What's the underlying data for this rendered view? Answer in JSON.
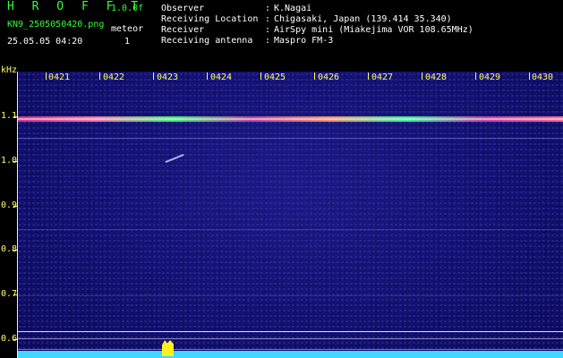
{
  "header": {
    "app_title": "H R O F F T",
    "version": "1.0.0f",
    "filename": "KN9_2505050420.png",
    "timestamp": "25.05.05 04:20",
    "meteor_label": "meteor",
    "meteor_count": "1"
  },
  "info": {
    "rows": [
      {
        "label": "Observer",
        "value": "K.Nagai"
      },
      {
        "label": "Receiving Location",
        "value": "Chigasaki, Japan (139.414 35.340)"
      },
      {
        "label": "Receiver",
        "value": "AirSpy mini (Miakejima VOR 108.65MHz)"
      },
      {
        "label": "Receiving antenna",
        "value": "Maspro FM-3"
      }
    ],
    "separator": ":"
  },
  "axes": {
    "y_unit": "kHz",
    "y_ticks": [
      "1.1",
      "1.0",
      "0.9",
      "0.8",
      "0.7",
      "0.6"
    ],
    "x_ticks": [
      "0421",
      "0422",
      "0423",
      "0424",
      "0425",
      "0426",
      "0427",
      "0428",
      "0429",
      "0430"
    ]
  },
  "colors": {
    "header_green": "#33ff33",
    "axis_yellow": "#ffff66",
    "background": "#000000",
    "spectrum_blue": "#12106a",
    "baseline_cyan": "#3fd8ff"
  }
}
